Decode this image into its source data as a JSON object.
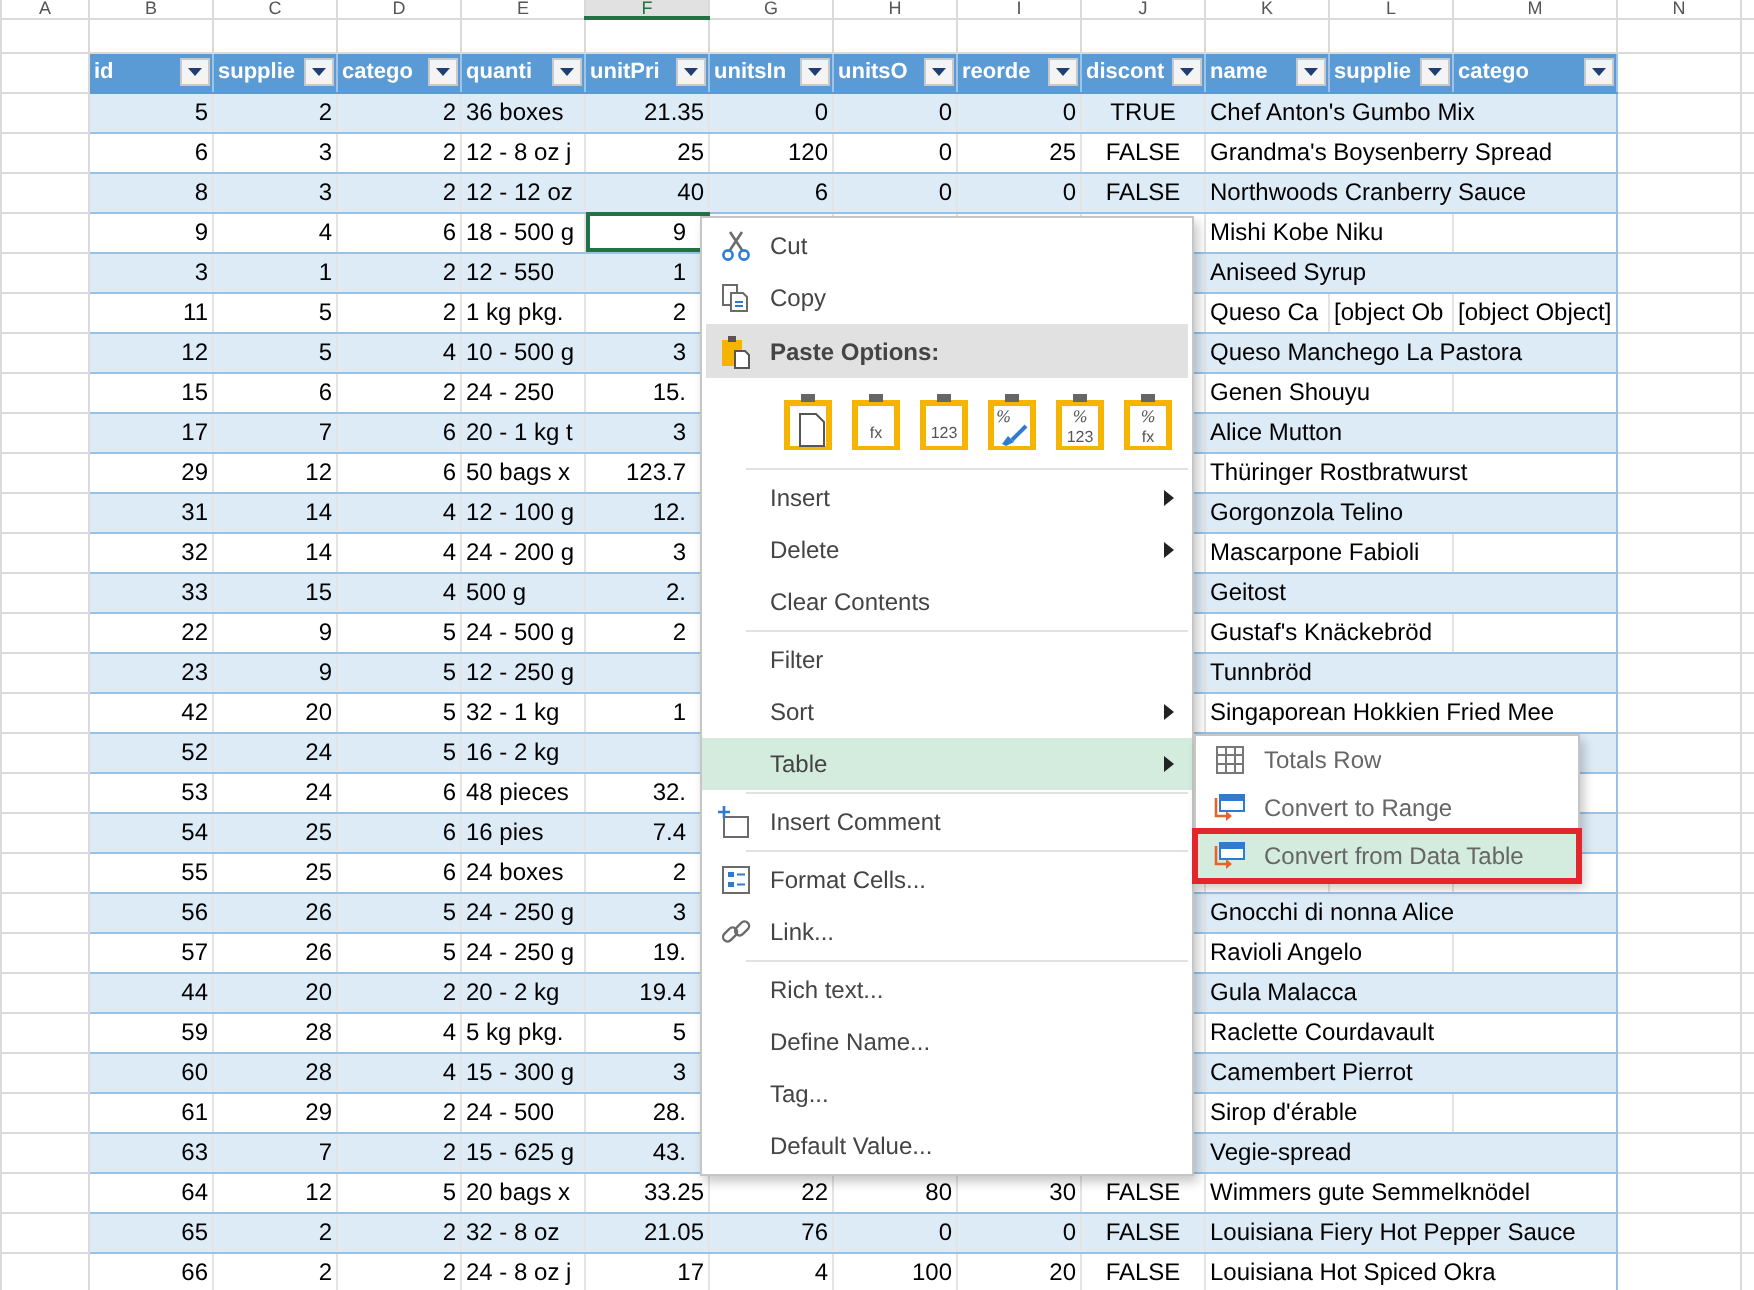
{
  "column_letters": [
    {
      "label": "A",
      "selected": false
    },
    {
      "label": "B",
      "selected": false
    },
    {
      "label": "C",
      "selected": false
    },
    {
      "label": "D",
      "selected": false
    },
    {
      "label": "E",
      "selected": false
    },
    {
      "label": "F",
      "selected": true
    },
    {
      "label": "G",
      "selected": false
    },
    {
      "label": "H",
      "selected": false
    },
    {
      "label": "I",
      "selected": false
    },
    {
      "label": "J",
      "selected": false
    },
    {
      "label": "K",
      "selected": false
    },
    {
      "label": "L",
      "selected": false
    },
    {
      "label": "M",
      "selected": false
    },
    {
      "label": "N",
      "selected": false
    }
  ],
  "table": {
    "columns": [
      {
        "label": "id",
        "kind": "number"
      },
      {
        "label": "supplie",
        "kind": "number"
      },
      {
        "label": "catego",
        "kind": "number"
      },
      {
        "label": "quanti",
        "kind": "text"
      },
      {
        "label": "unitPri",
        "kind": "number"
      },
      {
        "label": "unitsIn",
        "kind": "number"
      },
      {
        "label": "unitsO",
        "kind": "number"
      },
      {
        "label": "reorde",
        "kind": "number"
      },
      {
        "label": "discont",
        "kind": "boolean"
      },
      {
        "label": "name",
        "kind": "text"
      },
      {
        "label": "supplie",
        "kind": "text"
      },
      {
        "label": "catego",
        "kind": "text"
      }
    ],
    "rows": [
      {
        "selected": false,
        "cells": [
          "5",
          "2",
          "2",
          "36 boxes",
          "21.35",
          "0",
          "0",
          "0",
          "TRUE",
          {
            "text": "Chef Anton's Gumbo Mix",
            "colspan": 3
          }
        ]
      },
      {
        "selected": false,
        "cells": [
          "6",
          "3",
          "2",
          "12 - 8 oz j",
          "25",
          "120",
          "0",
          "25",
          "FALSE",
          {
            "text": "Grandma's Boysenberry Spread",
            "colspan": 3
          }
        ]
      },
      {
        "selected": false,
        "cells": [
          "8",
          "3",
          "2",
          "12 - 12 oz",
          "40",
          "6",
          "0",
          "0",
          "FALSE",
          {
            "text": "Northwoods Cranberry Sauce",
            "colspan": 3
          }
        ]
      },
      {
        "selected": true,
        "cells": [
          "9",
          "4",
          "6",
          "18 - 500 g",
          "9",
          null,
          null,
          null,
          null,
          {
            "text": "Mishi Kobe Niku",
            "colspan": 2
          },
          null
        ]
      },
      {
        "selected": false,
        "cells": [
          "3",
          "1",
          "2",
          "12 - 550",
          "1",
          null,
          null,
          null,
          null,
          {
            "text": "Aniseed Syrup",
            "colspan": 3
          }
        ]
      },
      {
        "selected": false,
        "cells": [
          "11",
          "5",
          "2",
          "1 kg pkg.",
          "2",
          null,
          null,
          null,
          null,
          "Queso Ca",
          "[object Ob",
          "[object Object]"
        ]
      },
      {
        "selected": false,
        "cells": [
          "12",
          "5",
          "4",
          "10 - 500 g",
          "3",
          null,
          null,
          null,
          null,
          {
            "text": "Queso Manchego La Pastora",
            "colspan": 3
          }
        ]
      },
      {
        "selected": false,
        "cells": [
          "15",
          "6",
          "2",
          "24 - 250",
          "15.",
          null,
          null,
          null,
          null,
          {
            "text": "Genen Shouyu",
            "colspan": 2
          },
          null
        ]
      },
      {
        "selected": false,
        "cells": [
          "17",
          "7",
          "6",
          "20 - 1 kg t",
          "3",
          null,
          null,
          null,
          null,
          {
            "text": "Alice Mutton",
            "colspan": 3
          }
        ]
      },
      {
        "selected": false,
        "cells": [
          "29",
          "12",
          "6",
          "50 bags x",
          "123.7",
          null,
          null,
          null,
          null,
          {
            "text": "Thüringer Rostbratwurst",
            "colspan": 3
          }
        ]
      },
      {
        "selected": false,
        "cells": [
          "31",
          "14",
          "4",
          "12 - 100 g",
          "12.",
          null,
          null,
          null,
          null,
          {
            "text": "Gorgonzola Telino",
            "colspan": 3
          }
        ]
      },
      {
        "selected": false,
        "cells": [
          "32",
          "14",
          "4",
          "24 - 200 g",
          "3",
          null,
          null,
          null,
          null,
          {
            "text": "Mascarpone Fabioli",
            "colspan": 2
          },
          null
        ]
      },
      {
        "selected": false,
        "cells": [
          "33",
          "15",
          "4",
          "500 g",
          "2.",
          null,
          null,
          null,
          null,
          {
            "text": "Geitost",
            "colspan": 3
          }
        ]
      },
      {
        "selected": false,
        "cells": [
          "22",
          "9",
          "5",
          "24 - 500 g",
          "2",
          null,
          null,
          null,
          null,
          {
            "text": "Gustaf's Knäckebröd",
            "colspan": 2
          },
          null
        ]
      },
      {
        "selected": false,
        "cells": [
          "23",
          "9",
          "5",
          "12 - 250 g",
          null,
          null,
          null,
          null,
          null,
          {
            "text": "Tunnbröd",
            "colspan": 3
          }
        ]
      },
      {
        "selected": false,
        "cells": [
          "42",
          "20",
          "5",
          "32 - 1 kg",
          "1",
          null,
          null,
          null,
          null,
          {
            "text": "Singaporean Hokkien Fried Mee",
            "colspan": 3
          }
        ]
      },
      {
        "selected": false,
        "cells": [
          "52",
          "24",
          "5",
          "16 - 2 kg",
          null,
          null,
          null,
          null,
          null,
          null,
          null,
          null
        ]
      },
      {
        "selected": false,
        "cells": [
          "53",
          "24",
          "6",
          "48 pieces",
          "32.",
          null,
          null,
          null,
          null,
          null,
          null,
          null
        ]
      },
      {
        "selected": false,
        "cells": [
          "54",
          "25",
          "6",
          "16 pies",
          "7.4",
          null,
          null,
          null,
          null,
          null,
          null,
          null
        ]
      },
      {
        "selected": false,
        "cells": [
          "55",
          "25",
          "6",
          "24 boxes",
          "2",
          null,
          null,
          null,
          null,
          null,
          null,
          null
        ]
      },
      {
        "selected": false,
        "cells": [
          "56",
          "26",
          "5",
          "24 - 250 g",
          "3",
          null,
          null,
          null,
          null,
          {
            "text": "Gnocchi di nonna Alice",
            "colspan": 3
          }
        ]
      },
      {
        "selected": false,
        "cells": [
          "57",
          "26",
          "5",
          "24 - 250 g",
          "19.",
          null,
          null,
          null,
          null,
          {
            "text": "Ravioli Angelo",
            "colspan": 2
          },
          null
        ]
      },
      {
        "selected": false,
        "cells": [
          "44",
          "20",
          "2",
          "20 - 2 kg",
          "19.4",
          null,
          null,
          null,
          null,
          {
            "text": "Gula Malacca",
            "colspan": 3
          }
        ]
      },
      {
        "selected": false,
        "cells": [
          "59",
          "28",
          "4",
          "5 kg pkg.",
          "5",
          null,
          null,
          null,
          null,
          {
            "text": "Raclette Courdavault",
            "colspan": 3
          }
        ]
      },
      {
        "selected": false,
        "cells": [
          "60",
          "28",
          "4",
          "15 - 300 g",
          "3",
          null,
          null,
          null,
          null,
          {
            "text": "Camembert Pierrot",
            "colspan": 3
          }
        ]
      },
      {
        "selected": false,
        "cells": [
          "61",
          "29",
          "2",
          "24 - 500",
          "28.",
          null,
          null,
          null,
          null,
          {
            "text": "Sirop d'érable",
            "colspan": 2
          },
          null
        ]
      },
      {
        "selected": false,
        "cells": [
          "63",
          "7",
          "2",
          "15 - 625 g",
          "43.",
          null,
          null,
          null,
          null,
          {
            "text": "Vegie-spread",
            "colspan": 3
          }
        ]
      },
      {
        "selected": false,
        "cells": [
          "64",
          "12",
          "5",
          "20 bags x",
          "33.25",
          "22",
          "80",
          "30",
          "FALSE",
          {
            "text": "Wimmers gute Semmelknödel",
            "colspan": 3
          }
        ]
      },
      {
        "selected": false,
        "cells": [
          "65",
          "2",
          "2",
          "32 - 8 oz",
          "21.05",
          "76",
          "0",
          "0",
          "FALSE",
          {
            "text": "Louisiana Fiery Hot Pepper Sauce",
            "colspan": 3
          }
        ]
      },
      {
        "selected": false,
        "cells": [
          "66",
          "2",
          "2",
          "24 - 8 oz j",
          "17",
          "4",
          "100",
          "20",
          "FALSE",
          {
            "text": "Louisiana Hot Spiced Okra",
            "colspan": 3
          }
        ]
      }
    ]
  },
  "context_menu": {
    "items": [
      {
        "kind": "cut",
        "label": "Cut",
        "has_submenu": false,
        "highlighted": false
      },
      {
        "kind": "copy",
        "label": "Copy",
        "has_submenu": false,
        "highlighted": false
      },
      {
        "kind": "paste_header",
        "label": "Paste Options:"
      },
      {
        "kind": "paste_options",
        "options": [
          {
            "kind": "all"
          },
          {
            "kind": "formulas",
            "glyphs": [
              "fx"
            ]
          },
          {
            "kind": "values",
            "glyphs": [
              "123"
            ]
          },
          {
            "kind": "formatting",
            "glyphs": [
              "%"
            ]
          },
          {
            "kind": "values_formatting",
            "glyphs": [
              "%",
              "123"
            ]
          },
          {
            "kind": "formulas_formatting",
            "glyphs": [
              "%",
              "fx"
            ]
          }
        ]
      },
      {
        "kind": "separator"
      },
      {
        "kind": "command",
        "label": "Insert",
        "has_submenu": true,
        "highlighted": false
      },
      {
        "kind": "command",
        "label": "Delete",
        "has_submenu": true,
        "highlighted": false
      },
      {
        "kind": "command",
        "label": "Clear Contents",
        "has_submenu": false,
        "highlighted": false
      },
      {
        "kind": "separator"
      },
      {
        "kind": "command",
        "label": "Filter",
        "has_submenu": false,
        "highlighted": false
      },
      {
        "kind": "command",
        "label": "Sort",
        "has_submenu": true,
        "highlighted": false
      },
      {
        "kind": "command",
        "label": "Table",
        "has_submenu": true,
        "highlighted": true,
        "children": [
          {
            "kind": "totals",
            "label": "Totals Row",
            "highlighted": false,
            "marked": false
          },
          {
            "kind": "convert",
            "label": "Convert to Range",
            "highlighted": false,
            "marked": false
          },
          {
            "kind": "convert",
            "label": "Convert from Data Table",
            "highlighted": true,
            "marked": true
          }
        ]
      },
      {
        "kind": "separator"
      },
      {
        "kind": "comment",
        "label": "Insert Comment",
        "has_submenu": false,
        "highlighted": false
      },
      {
        "kind": "separator"
      },
      {
        "kind": "format",
        "label": "Format Cells...",
        "has_submenu": false,
        "highlighted": false
      },
      {
        "kind": "link",
        "label": "Link...",
        "has_submenu": false,
        "highlighted": false
      },
      {
        "kind": "separator"
      },
      {
        "kind": "command",
        "label": "Rich text...",
        "has_submenu": false,
        "highlighted": false
      },
      {
        "kind": "command",
        "label": "Define Name...",
        "has_submenu": false,
        "highlighted": false
      },
      {
        "kind": "command",
        "label": "Tag...",
        "has_submenu": false,
        "highlighted": false
      },
      {
        "kind": "command",
        "label": "Default Value...",
        "has_submenu": false,
        "highlighted": false
      }
    ]
  }
}
